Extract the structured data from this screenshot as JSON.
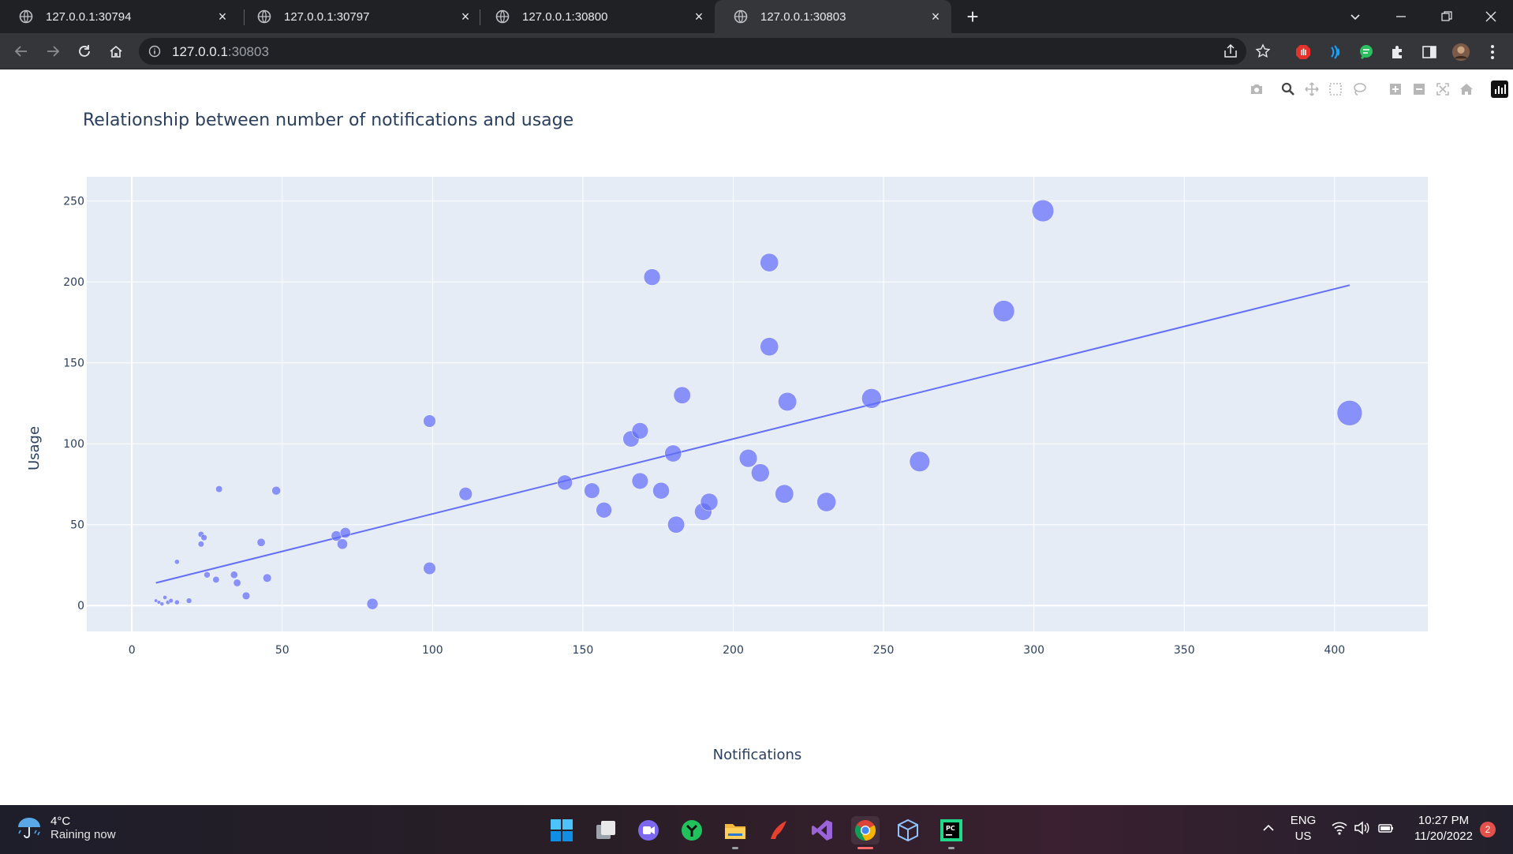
{
  "browser": {
    "tabs": [
      {
        "title": "127.0.0.1:30794",
        "active": false
      },
      {
        "title": "127.0.0.1:30797",
        "active": false
      },
      {
        "title": "127.0.0.1:30800",
        "active": false
      },
      {
        "title": "127.0.0.1:30803",
        "active": true
      }
    ],
    "close_glyph": "×",
    "new_tab_glyph": "+",
    "url_host": "127.0.0.1",
    "url_port": ":30803"
  },
  "chart_data": {
    "type": "scatter",
    "title": "Relationship between number of notifications and usage",
    "xlabel": "Notifications",
    "ylabel": "Usage",
    "xlim": [
      -15,
      431
    ],
    "ylim": [
      -16,
      265
    ],
    "x_ticks": [
      0,
      50,
      100,
      150,
      200,
      250,
      300,
      350,
      400
    ],
    "y_ticks": [
      0,
      50,
      100,
      150,
      200,
      250
    ],
    "grid": true,
    "legend": "none",
    "marker_color": "#636efa",
    "marker_size_encodes": "Notifications",
    "points": [
      {
        "x": 8,
        "y": 3
      },
      {
        "x": 9,
        "y": 2
      },
      {
        "x": 10,
        "y": 1
      },
      {
        "x": 11,
        "y": 5
      },
      {
        "x": 12,
        "y": 2
      },
      {
        "x": 13,
        "y": 3
      },
      {
        "x": 15,
        "y": 2
      },
      {
        "x": 15,
        "y": 27
      },
      {
        "x": 19,
        "y": 3
      },
      {
        "x": 23,
        "y": 44
      },
      {
        "x": 23,
        "y": 38
      },
      {
        "x": 24,
        "y": 42
      },
      {
        "x": 25,
        "y": 19
      },
      {
        "x": 28,
        "y": 16
      },
      {
        "x": 29,
        "y": 72
      },
      {
        "x": 34,
        "y": 19
      },
      {
        "x": 35,
        "y": 14
      },
      {
        "x": 38,
        "y": 6
      },
      {
        "x": 43,
        "y": 39
      },
      {
        "x": 45,
        "y": 17
      },
      {
        "x": 48,
        "y": 71
      },
      {
        "x": 68,
        "y": 43
      },
      {
        "x": 70,
        "y": 38
      },
      {
        "x": 71,
        "y": 45
      },
      {
        "x": 80,
        "y": 1
      },
      {
        "x": 99,
        "y": 114
      },
      {
        "x": 99,
        "y": 23
      },
      {
        "x": 111,
        "y": 69
      },
      {
        "x": 144,
        "y": 76
      },
      {
        "x": 153,
        "y": 71
      },
      {
        "x": 157,
        "y": 59
      },
      {
        "x": 166,
        "y": 103
      },
      {
        "x": 169,
        "y": 108
      },
      {
        "x": 169,
        "y": 77
      },
      {
        "x": 173,
        "y": 203
      },
      {
        "x": 176,
        "y": 71
      },
      {
        "x": 180,
        "y": 94
      },
      {
        "x": 181,
        "y": 50
      },
      {
        "x": 183,
        "y": 130
      },
      {
        "x": 190,
        "y": 58
      },
      {
        "x": 192,
        "y": 64
      },
      {
        "x": 205,
        "y": 91
      },
      {
        "x": 209,
        "y": 82
      },
      {
        "x": 212,
        "y": 212
      },
      {
        "x": 212,
        "y": 160
      },
      {
        "x": 217,
        "y": 69
      },
      {
        "x": 218,
        "y": 126
      },
      {
        "x": 231,
        "y": 64
      },
      {
        "x": 246,
        "y": 128
      },
      {
        "x": 262,
        "y": 89
      },
      {
        "x": 290,
        "y": 182
      },
      {
        "x": 303,
        "y": 244
      },
      {
        "x": 405,
        "y": 119
      }
    ],
    "trendline": {
      "x": [
        8,
        405
      ],
      "y": [
        14,
        198
      ]
    }
  },
  "taskbar": {
    "weather_temp": "4°C",
    "weather_cond": "Raining now",
    "lang_1": "ENG",
    "lang_2": "US",
    "time": "10:27 PM",
    "date": "11/20/2022",
    "notif_count": "2"
  }
}
